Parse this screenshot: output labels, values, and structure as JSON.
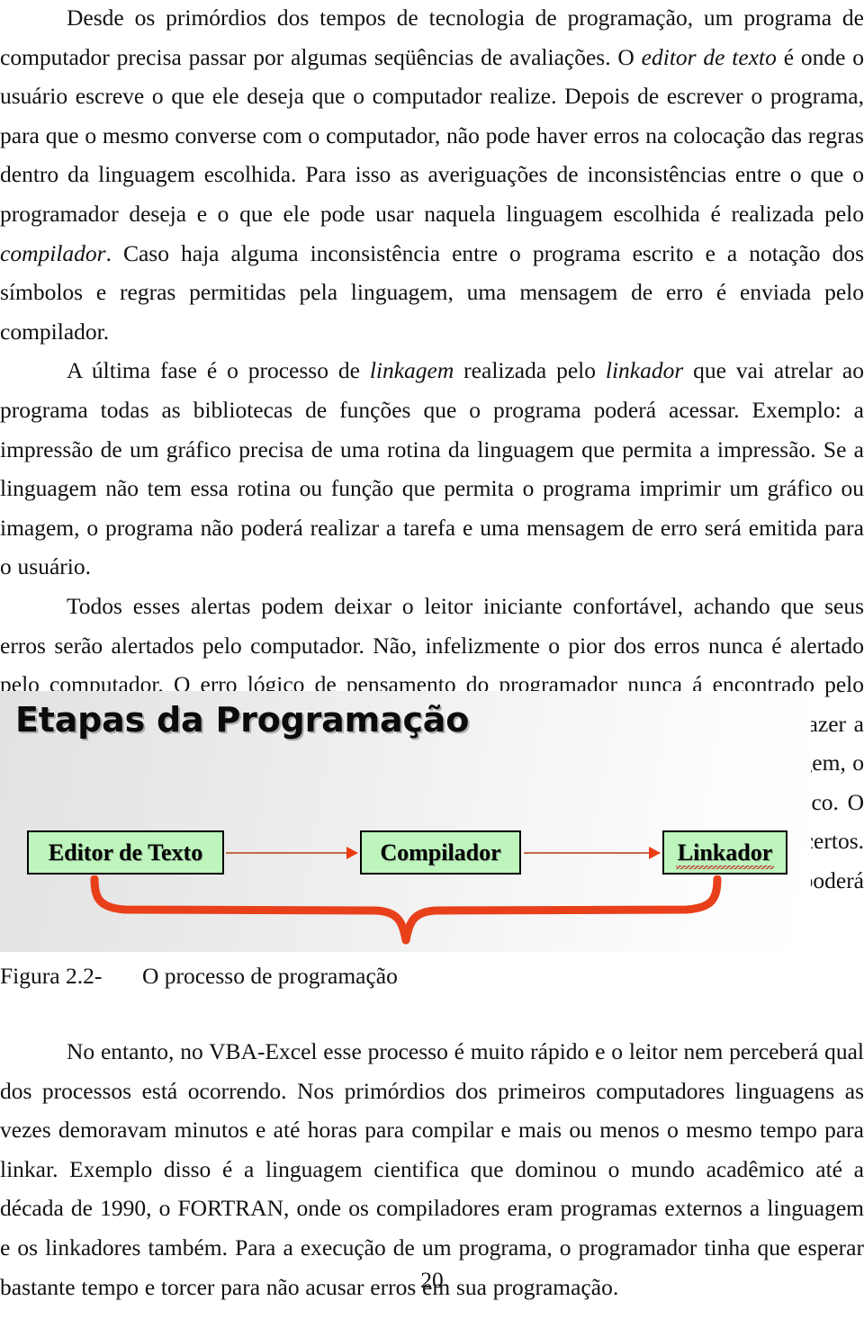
{
  "document": {
    "page_number": "20",
    "paragraphs_top": [
      "Desde os primórdios dos tempos de tecnologia de programação, um programa de computador precisa  passar por algumas seqüências de avaliações. O editor de texto é onde o usuário escreve o que ele deseja que o computador realize. Depois de escrever o programa, para que o mesmo converse com o computador, não pode haver erros na colocação das regras dentro da linguagem escolhida. Para isso as averiguações de inconsistências entre o que o programador deseja e o que ele pode usar naquela linguagem escolhida é realizada pelo compilador. Caso haja alguma inconsistência entre o programa escrito e a notação dos símbolos e regras permitidas pela linguagem, uma mensagem de erro é enviada pelo compilador.",
      "A última fase é o processo de linkagem realizada pelo linkador que vai atrelar ao programa todas as bibliotecas de funções que o programa poderá acessar. Exemplo: a impressão de um gráfico precisa de uma rotina da linguagem que permita a impressão. Se a linguagem não tem essa rotina ou função que permita o programa imprimir um gráfico ou imagem, o programa não poderá realizar a tarefa e uma mensagem de erro será emitida para o usuário.",
      "Todos esses alertas podem deixar o leitor iniciante confortável, achando que seus erros serão alertados pelo computador. Não, infelizmente o pior dos erros nunca é alertado pelo computador. O erro lógico de pensamento do programador nunca á encontrado pelo computador. Exemplo: se o programador enviou uma ordem para que o computador fazer a operação 2 + 3 = 4, se a regra de soma estiver de acordo com as permissões da linguagem, o computador vai enviar ao usuário a mensagem que dois mais três é quatro e não cinco. O problema é que o computador recebeu uma ordem lógica errada, mas com comandos certos. Assim, caro leitor, lembre-se que seus erros de programação somente um ser humano poderá encontrar ( no VBA-Excel pelo menos )."
    ],
    "paragraph_fragments": {
      "p1_a": "Desde os primórdios dos tempos de tecnologia de programação, um programa de computador precisa  passar por algumas seqüências de avaliações. O ",
      "p1_i1": "editor de texto",
      "p1_b": " é onde o usuário escreve o que ele deseja que o computador realize. Depois de escrever o programa, para que o mesmo converse com o computador, não pode haver erros na colocação das regras dentro da linguagem escolhida. Para isso as averiguações de inconsistências entre o que o programador deseja e o que ele pode usar naquela linguagem escolhida é realizada pelo ",
      "p1_i2": "compilador",
      "p1_c": ". Caso haja alguma inconsistência entre o programa escrito e a notação dos símbolos e regras permitidas pela linguagem, uma mensagem de erro é enviada pelo compilador.",
      "p2_a": "A última fase é o processo de ",
      "p2_i1": "linkagem",
      "p2_b": " realizada pelo ",
      "p2_i2": "linkador",
      "p2_c": " que vai atrelar ao programa todas as bibliotecas de funções que o programa poderá acessar. Exemplo: a impressão de um gráfico precisa de uma rotina da linguagem que permita a impressão. Se a linguagem não tem essa rotina ou função que permita o programa imprimir um gráfico ou imagem, o programa não poderá realizar a tarefa e uma mensagem de erro será emitida para o usuário.",
      "p3": "Todos esses alertas podem deixar o leitor iniciante confortável, achando que seus erros serão alertados pelo computador. Não, infelizmente o pior dos erros nunca é alertado pelo computador. O erro lógico de pensamento do programador nunca á encontrado pelo computador. Exemplo: se o programador enviou uma ordem para que o computador fazer a operação 2 + 3 = 4, se a regra de soma estiver de acordo com as permissões da linguagem, o computador vai enviar ao usuário a mensagem que dois mais três é quatro e não cinco. O problema é que o computador recebeu uma ordem lógica errada, mas com comandos certos. Assim, caro leitor, lembre-se que seus erros de programação somente um ser humano poderá encontrar ( no VBA-Excel pelo menos ).",
      "p4": "No entanto, no VBA-Excel esse processo é muito rápido e o leitor nem perceberá qual dos processos está ocorrendo. Nos primórdios dos primeiros computadores linguagens as vezes demoravam minutos e até horas para compilar e mais ou menos o mesmo tempo para linkar. Exemplo disso é a linguagem cientifica que dominou o mundo acadêmico até a década de 1990, o FORTRAN, onde os compiladores eram programas externos a linguagem e os linkadores também. Para a execução de um programa, o programador tinha que esperar bastante tempo e torcer para não acusar erros em sua programação."
    }
  },
  "figure": {
    "title": "Etapas da Programação",
    "caption_label": "Figura 2.2-",
    "caption_text": "O processo de programação",
    "caption_full": "Figura 2.2-       O processo de programação",
    "boxes": [
      {
        "label": "Editor de Texto",
        "misspelled": false
      },
      {
        "label": "Compilador",
        "misspelled": false
      },
      {
        "label": "Linkador",
        "misspelled": true
      }
    ],
    "colors": {
      "box_fill": "#bdf5bd",
      "box_border": "#000000",
      "arrow_line": "#c46a44",
      "arrow_head": "#ee3b12",
      "brace": "#e8401a",
      "spellcheck_underline": "#c0392b",
      "background_gradient_start": "#e2e2e2",
      "background_gradient_end": "#ffffff"
    },
    "arrows": [
      {
        "from": "Editor de Texto",
        "to": "Compilador"
      },
      {
        "from": "Compilador",
        "to": "Linkador"
      }
    ],
    "brace": {
      "orientation": "down",
      "spans": "Editor de Texto to Linkador"
    }
  }
}
